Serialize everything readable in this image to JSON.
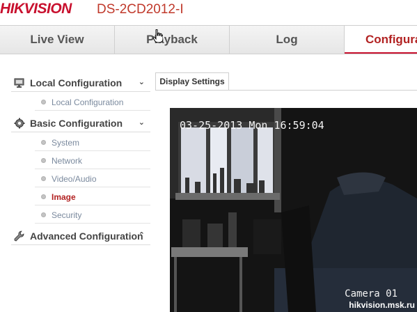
{
  "header": {
    "logo": "HIKVISION",
    "model": "DS-2CD2012-I"
  },
  "topnav": {
    "tabs": [
      "Live View",
      "Playback",
      "Log",
      "Configura"
    ],
    "active": "Configura"
  },
  "sidebar": {
    "local": {
      "label": "Local Configuration",
      "items": [
        "Local Configuration"
      ]
    },
    "basic": {
      "label": "Basic Configuration",
      "items": [
        "System",
        "Network",
        "Video/Audio",
        "Image",
        "Security"
      ],
      "active_item": "Image"
    },
    "advanced": {
      "label": "Advanced Configuration"
    }
  },
  "content": {
    "tab": "Display Settings"
  },
  "video": {
    "osd_date": "03-25-2013 Mon 16:59:04",
    "osd_camera": "Camera 01",
    "watermark": "hikvision.msk.ru"
  },
  "colors": {
    "brand": "#c8102e",
    "active_text": "#b22222",
    "sub_text": "#7b8a9e"
  },
  "icons": {
    "local": "monitor-icon",
    "basic": "gear-icon",
    "advanced": "wrench-icon",
    "cursor": "hand-cursor-icon"
  }
}
